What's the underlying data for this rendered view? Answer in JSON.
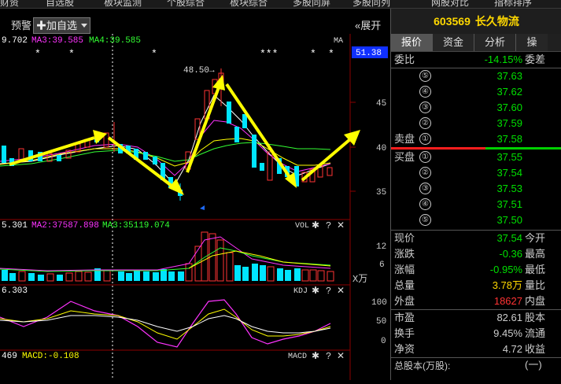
{
  "top_menu": [
    "财资",
    "自选股",
    "板块监测",
    "个股综合",
    "板块综合",
    "多股同屏",
    "多股同列",
    "网股对比",
    "指标排序"
  ],
  "toolbar": {
    "alert_label": "预警",
    "add_label": "✚加自选",
    "expand_label": "«展开"
  },
  "main_chart": {
    "ma_labels": [
      {
        "text": "9.702",
        "color": "#ffffff"
      },
      {
        "text": "MA3:39.585",
        "color": "#ff33ff"
      },
      {
        "text": "MA4:39.585",
        "color": "#33ff33"
      }
    ],
    "ma_tag": "MA",
    "price_box": "51.38",
    "y_ticks": [
      "45",
      "40",
      "35"
    ],
    "peak_label": "48.50→",
    "stars": [
      "*",
      "*",
      "*",
      "***",
      "*",
      "*"
    ]
  },
  "vol_panel": {
    "labels": [
      {
        "text": "5.301",
        "color": "#ffffff"
      },
      {
        "text": "MA2:37587.898",
        "color": "#ff33ff"
      },
      {
        "text": "MA3:35119.074",
        "color": "#33ff33"
      }
    ],
    "tag": "VOL",
    "y_ticks": [
      "12",
      "6"
    ],
    "unit": "X万"
  },
  "kdj_panel": {
    "labels": [
      {
        "text": "6.303",
        "color": "#ffffff"
      }
    ],
    "tag": "KDJ",
    "y_ticks": [
      "100",
      "50",
      "0"
    ]
  },
  "macd_panel": {
    "labels": [
      {
        "text": "469",
        "color": "#ffffff"
      },
      {
        "text": "MACD:-0.108",
        "color": "#ffff00"
      }
    ],
    "tag": "MACD"
  },
  "panel": {
    "code": "603569",
    "name": "长久物流",
    "tabs": [
      "报价",
      "资金",
      "分析",
      "操"
    ],
    "weibi": {
      "label": "委比",
      "value": "-14.15%",
      "right": "委差"
    },
    "sell_label": "卖盘",
    "buy_label": "买盘",
    "sell": [
      {
        "n": "⑤",
        "price": "37.63"
      },
      {
        "n": "④",
        "price": "37.62"
      },
      {
        "n": "③",
        "price": "37.60"
      },
      {
        "n": "②",
        "price": "37.59"
      },
      {
        "n": "①",
        "price": "37.58"
      }
    ],
    "buy": [
      {
        "n": "①",
        "price": "37.55"
      },
      {
        "n": "②",
        "price": "37.54"
      },
      {
        "n": "③",
        "price": "37.53"
      },
      {
        "n": "④",
        "price": "37.51"
      },
      {
        "n": "⑤",
        "price": "37.50"
      }
    ],
    "stats": [
      {
        "l": "现价",
        "v": "37.54",
        "r": "今开",
        "c": "#00e000"
      },
      {
        "l": "涨跌",
        "v": "-0.36",
        "r": "最高",
        "c": "#00e000"
      },
      {
        "l": "涨幅",
        "v": "-0.95%",
        "r": "最低",
        "c": "#00e000"
      },
      {
        "l": "总量",
        "v": "3.78万",
        "r": "量比",
        "c": "#ffd800"
      },
      {
        "l": "外盘",
        "v": "18627",
        "r": "内盘",
        "c": "#ff3333"
      },
      {
        "l": "市盈",
        "v": "82.61",
        "r": "股本",
        "c": "#cccccc"
      },
      {
        "l": "换手",
        "v": "9.45%",
        "r": "流通",
        "c": "#cccccc"
      },
      {
        "l": "净资",
        "v": "4.72",
        "r": "收益(一)",
        "c": "#cccccc"
      }
    ],
    "footer": "总股本(万股):"
  },
  "colors": {
    "up": "#ff3333",
    "down": "#00e5ff",
    "accent": "#ffd800",
    "arrow": "#ffff00"
  }
}
